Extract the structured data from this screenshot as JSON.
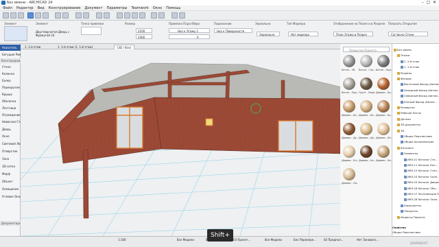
{
  "window": {
    "title": "Без имени - ARCHICAD 24"
  },
  "menu": [
    "Файл",
    "Редактор",
    "Вид",
    "Конструирование",
    "Документ",
    "Параметры",
    "Teamwork",
    "Окно",
    "Помощь"
  ],
  "infobox": {
    "labels": {
      "element": "Элемент",
      "geometry": "Геометрия",
      "open_rule": "Точка привязки",
      "size": "Размер",
      "window_anchor": "Привязка Порог/Верх",
      "sill": "Подоконник",
      "grid": "Граница Четверти",
      "mirror": "Зеркально",
      "marker": "Тип Маркера",
      "display_plan": "Отображение на Плане и в Разрезе",
      "layer": "Показать Открытие"
    },
    "values": {
      "element_name": "Двустворчатая Дверь с Фрамугой 24",
      "w": "2100",
      "h": "2400",
      "anchor": "Низ к Этажу 1",
      "anchor_val": "0",
      "sill_val": "Низ к Поверхности",
      "mirror_val": "Зеркально",
      "marker_val": "Нет маркера",
      "display_val": "План Этажа и Разрез",
      "layer_val": "Согласно Стене"
    }
  },
  "toolbox": {
    "header1": "Конструирование",
    "items": [
      "Указатель",
      "Бегущая Рамка",
      "Стена",
      "Колонна",
      "Балка",
      "Перекрытие",
      "Крыша",
      "Оболочка",
      "Лестница",
      "Ограждение",
      "Навесная Стена",
      "Дверь",
      "Окно",
      "Световой Люк",
      "Отверстие",
      "Зона",
      "3D-сетка",
      "Морф",
      "Объект",
      "Освещение",
      "Угловое Окно",
      "Документирование"
    ]
  },
  "tabs": [
    {
      "label": "1. 1-й этаж"
    },
    {
      "label": "1. 1-й этаж (1. 1-й этаж)"
    },
    {
      "label": "[3D / Все]"
    }
  ],
  "statusbar": {
    "items": [
      "1:100",
      "Все Модели",
      "Весь Проект",
      "03 Проект...",
      "Все Модели",
      "Без Переопре...",
      "02 Предпол...",
      "Нет Зонового..."
    ],
    "hint": "Shift+",
    "brand": "GRAPHISOFT"
  },
  "materials": {
    "search_placeholder": "Покрытия Проекта",
    "items": [
      {
        "label": "Бетон - 3D",
        "color": "#9a9a9a"
      },
      {
        "label": "Бетон - Гла...",
        "color": "#b9b9b9"
      },
      {
        "label": "Бетон - Под...",
        "color": "#7f7f7f"
      },
      {
        "label": "Бетон - Под...",
        "color": "#a7a29a"
      },
      {
        "label": "Грунт - Бере...",
        "color": "#6b5a44"
      },
      {
        "label": "Дерево - Ба...",
        "color": "#b8612e"
      },
      {
        "label": "Дерево - Бе...",
        "color": "#c89d6a"
      },
      {
        "label": "Дерево - Бе...",
        "color": "#d7b285"
      },
      {
        "label": "Дерево - Бу...",
        "color": "#b98555"
      },
      {
        "label": "Дерево - Ду...",
        "color": "#8f5a33"
      },
      {
        "label": "Дерево - Ду...",
        "color": "#d9b98a"
      },
      {
        "label": "Дерево - Ке...",
        "color": "#e2c299"
      },
      {
        "label": "Дерево - Кл...",
        "color": "#e6cfae"
      },
      {
        "label": "Дерево - Ко...",
        "color": "#6b4328"
      },
      {
        "label": "Дерево - Ко...",
        "color": "#c5a57b"
      },
      {
        "label": "Дерево - Ли...",
        "color": "#d8bc94"
      }
    ]
  },
  "navigator": {
    "items": [
      {
        "label": "Без имени",
        "depth": 0
      },
      {
        "label": "Этажи",
        "depth": 1
      },
      {
        "label": "2. 2-й этаж",
        "depth": 2
      },
      {
        "label": "1. 1-й этаж",
        "depth": 2
      },
      {
        "label": "Разрезы",
        "depth": 1
      },
      {
        "label": "Фасады",
        "depth": 1
      },
      {
        "label": "Восточный Фасад (Автом...",
        "depth": 2
      },
      {
        "label": "Западный Фасад (Автом...",
        "depth": 2
      },
      {
        "label": "Северный Фасад (Автом...",
        "depth": 2
      },
      {
        "label": "Южный Фасад (Автом...",
        "depth": 2
      },
      {
        "label": "Развертки",
        "depth": 1
      },
      {
        "label": "Рабочие Листы",
        "depth": 1
      },
      {
        "label": "Детали",
        "depth": 1
      },
      {
        "label": "3D-документы",
        "depth": 1
      },
      {
        "label": "3D",
        "depth": 1
      },
      {
        "label": "Общая Перспектива",
        "depth": 2
      },
      {
        "label": "Общая Аксонометрия",
        "depth": 2
      },
      {
        "label": "Каталоги",
        "depth": 1
      },
      {
        "label": "Элементы",
        "depth": 2
      },
      {
        "label": "ИКЭ-01 Каталог Сте...",
        "depth": 3
      },
      {
        "label": "ИКЭ-11 Каталог Кол...",
        "depth": 3
      },
      {
        "label": "ИКЭ-23 Каталог Стен...",
        "depth": 3
      },
      {
        "label": "ИКЭ-24 Каталог Окон...",
        "depth": 3
      },
      {
        "label": "ИКЭ-25 Каталог Дверей",
        "depth": 3
      },
      {
        "label": "ИКЭ-26 Каталог Объ...",
        "depth": 3
      },
      {
        "label": "ИКЭ-27 Экспликация П...",
        "depth": 3
      },
      {
        "label": "ИКЭ-28 Каталог Окон...",
        "depth": 3
      },
      {
        "label": "Компоненты",
        "depth": 2
      },
      {
        "label": "Покрытия",
        "depth": 2
      },
      {
        "label": "Индексы Проекта",
        "depth": 1
      }
    ],
    "footer": [
      "Свойства",
      "Общая Перспектива",
      "Параметры..."
    ]
  }
}
